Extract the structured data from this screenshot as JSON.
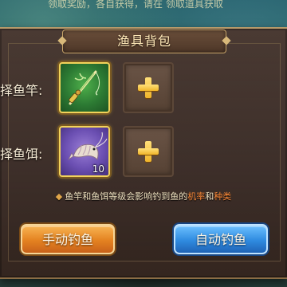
{
  "background_text": "领取奖励，各自获得，请在 领取道具获取",
  "panel": {
    "title": "渔具背包"
  },
  "rod_row": {
    "label": "择鱼竿:",
    "equipped_icon": "fishing-rod-icon",
    "empty_icon": "plus-icon"
  },
  "bait_row": {
    "label": "择鱼饵:",
    "equipped_icon": "shrimp-bait-icon",
    "equipped_count": "10",
    "empty_icon": "plus-icon"
  },
  "hint": {
    "bullet": "◆",
    "part1": "鱼竿和鱼饵等级会影响钓到鱼的",
    "accent1": "机率",
    "part2": "和",
    "accent2": "种类"
  },
  "buttons": {
    "manual": "手动钓鱼",
    "auto": "自动钓鱼"
  },
  "colors": {
    "accent_orange": "#ff8c3a",
    "manual_button": "#e48220",
    "auto_button": "#2f8be0",
    "slot_border": "#f2d35a"
  }
}
